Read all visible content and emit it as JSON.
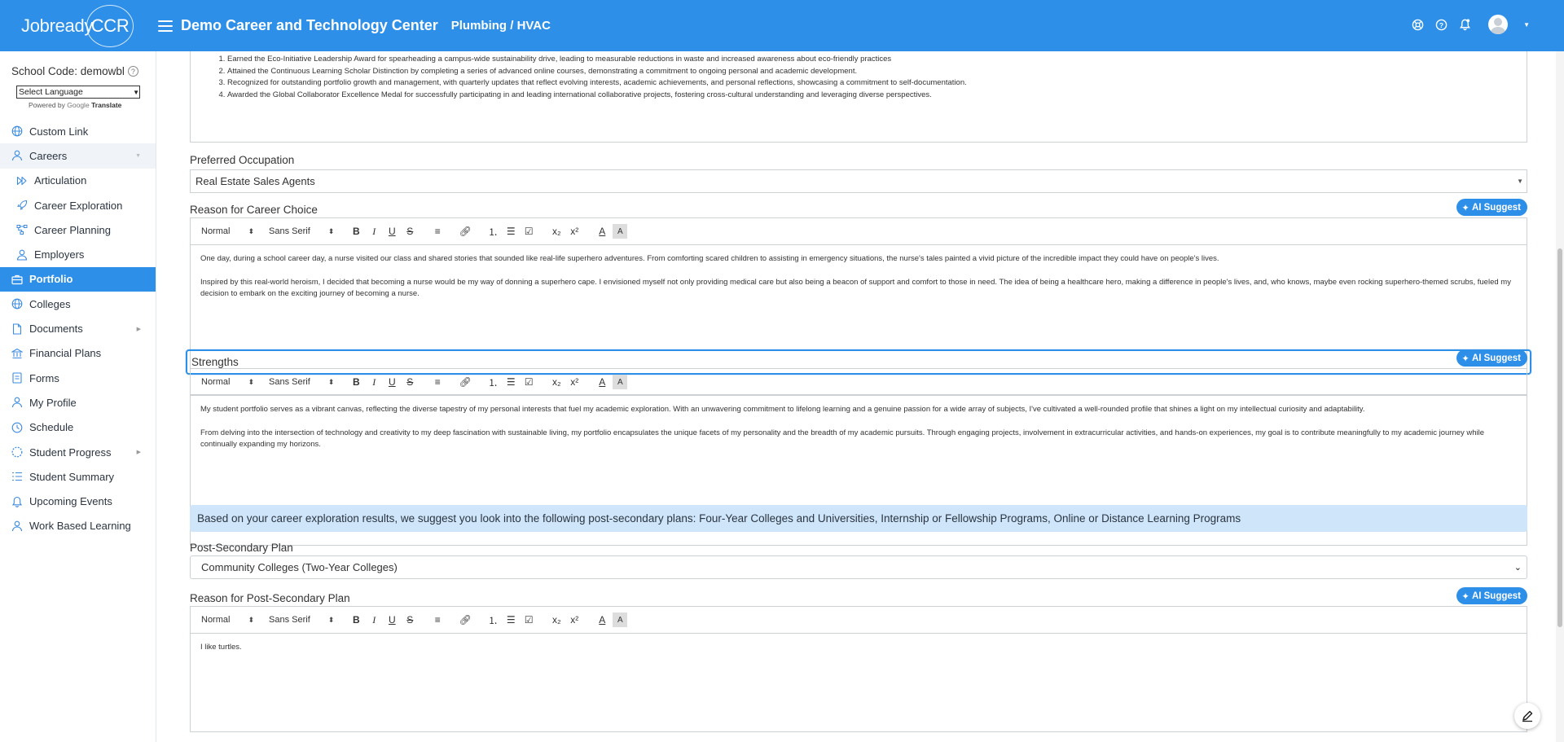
{
  "header": {
    "logo_text": "Jobready",
    "logo_ring_text": "CCR",
    "org_title": "Demo Career and Technology Center",
    "program": "Plumbing / HVAC"
  },
  "sidebar": {
    "school_code": "School Code: demowbl",
    "language_select": "Select Language",
    "powered_by": "Powered by",
    "google": "Google",
    "translate": "Translate",
    "items": [
      {
        "label": "Custom Link",
        "icon": "globe-icon"
      },
      {
        "label": "Careers",
        "icon": "user-tie-icon"
      },
      {
        "label": "Articulation",
        "icon": "forward-icon"
      },
      {
        "label": "Career Exploration",
        "icon": "rocket-icon"
      },
      {
        "label": "Career Planning",
        "icon": "flow-icon"
      },
      {
        "label": "Employers",
        "icon": "person-icon"
      },
      {
        "label": "Portfolio",
        "icon": "briefcase-icon"
      },
      {
        "label": "Colleges",
        "icon": "globe-icon"
      },
      {
        "label": "Documents",
        "icon": "document-icon"
      },
      {
        "label": "Financial Plans",
        "icon": "bank-icon"
      },
      {
        "label": "Forms",
        "icon": "form-icon"
      },
      {
        "label": "My Profile",
        "icon": "person-icon"
      },
      {
        "label": "Schedule",
        "icon": "clock-icon"
      },
      {
        "label": "Student Progress",
        "icon": "progress-icon"
      },
      {
        "label": "Student Summary",
        "icon": "list-icon"
      },
      {
        "label": "Upcoming Events",
        "icon": "bell-icon"
      },
      {
        "label": "Work Based Learning",
        "icon": "person-icon"
      }
    ]
  },
  "achievements": [
    "Earned the Eco-Initiative Leadership Award for spearheading a campus-wide sustainability drive, leading to measurable reductions in waste and increased awareness about eco-friendly practices",
    "Attained the Continuous Learning Scholar Distinction by completing a series of advanced online courses, demonstrating a commitment to ongoing personal and academic development.",
    "Recognized for outstanding portfolio growth and management, with quarterly updates that reflect evolving interests, academic achievements, and personal reflections, showcasing a commitment to self-documentation.",
    " Awarded the Global Collaborator Excellence Medal for successfully participating in and leading international collaborative projects, fostering cross-cultural understanding and leveraging diverse perspectives."
  ],
  "preferred_occupation": {
    "label": "Preferred Occupation",
    "value": "Real Estate Sales Agents"
  },
  "ai_suggest_label": "AI Suggest",
  "toolbar": {
    "size": "Normal",
    "font": "Sans Serif"
  },
  "career_reason": {
    "label": "Reason for Career Choice",
    "paragraphs": [
      "One day, during a school career day, a nurse visited our class and shared stories that sounded like real-life superhero adventures. From comforting scared children to assisting in emergency situations, the nurse's tales painted a vivid picture of the incredible impact they could have on people's lives.",
      "Inspired by this real-world heroism, I decided that becoming a nurse would be my way of donning a superhero cape. I envisioned myself not only providing medical care but also being a beacon of support and comfort to those in need. The idea of being a healthcare hero, making a difference in people's lives, and, who knows, maybe even rocking superhero-themed scrubs, fueled my decision to embark on the exciting journey of becoming a nurse."
    ]
  },
  "strengths": {
    "label": "Strengths",
    "paragraphs": [
      "My student portfolio serves as a vibrant canvas, reflecting the diverse tapestry of my personal interests that fuel my academic exploration. With an unwavering commitment to lifelong learning and a genuine passion for a wide array of subjects, I've cultivated a well-rounded profile that shines a light on my intellectual curiosity and adaptability.",
      "From delving into the intersection of technology and creativity to my deep fascination with sustainable living, my portfolio encapsulates the unique facets of my personality and the breadth of my academic pursuits. Through engaging projects, involvement in extracurricular activities, and hands-on experiences, my goal is to contribute meaningfully to my academic journey while continually expanding my horizons."
    ]
  },
  "suggestion_banner": "Based on your career exploration results, we suggest you look into the following post-secondary plans: Four-Year Colleges and Universities, Internship or Fellowship Programs, Online or Distance Learning Programs",
  "post_secondary": {
    "label": "Post-Secondary Plan",
    "value": "Community Colleges (Two-Year Colleges)"
  },
  "post_secondary_reason": {
    "label": "Reason for Post-Secondary Plan",
    "text": "I like turtles."
  }
}
